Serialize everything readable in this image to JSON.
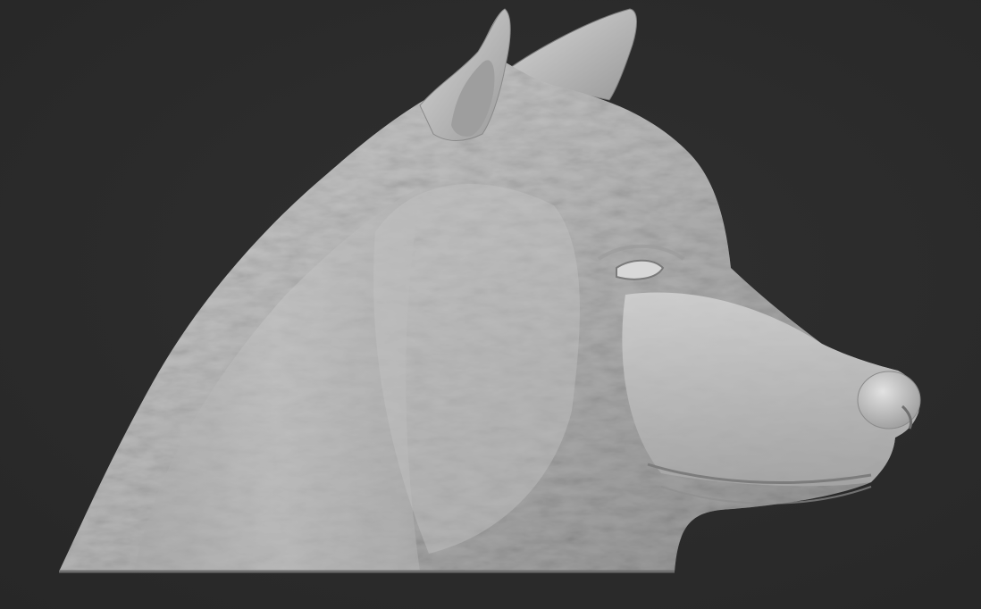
{
  "viewport": {
    "background_color": "#2b2b2b",
    "subject": "wolf-head-sculpt",
    "material_color": "#b9b9b9"
  }
}
